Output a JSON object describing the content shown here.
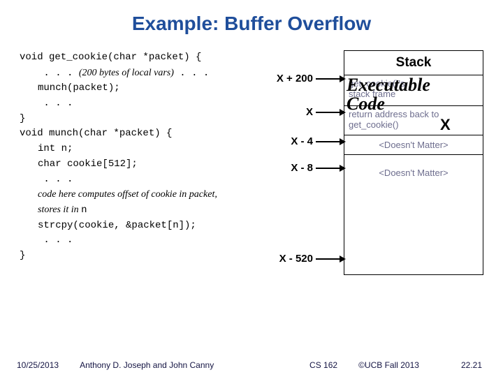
{
  "title": "Example: Buffer Overflow",
  "code": {
    "l1": "void get_cookie(char *packet) {",
    "l2a": " . . . ",
    "l2b": "(200 bytes of local vars)",
    "l2c": " . . .",
    "l3": "munch(packet);",
    "l4": " . . .",
    "l5": "}",
    "l6": "void munch(char *packet) {",
    "l7": "int n;",
    "l8": "char cookie[512];",
    "l9": " . . .",
    "l10": "code here computes offset of cookie in\npacket, stores it in ",
    "l10b": "n",
    "l11": "strcpy(cookie, &packet[n]);",
    "l12": " . . .",
    "l13": "}"
  },
  "addresses": {
    "a1": "X + 200",
    "a2": "X",
    "a3": "X - 4",
    "a4": "X - 8",
    "a5": "X - 520"
  },
  "stack": {
    "header": "Stack",
    "frame1": "get_cookie()'s",
    "frame2": "stack frame",
    "ret": "return address back to get_cookie()",
    "dm": "<Doesn't Matter>"
  },
  "overlay": {
    "line1": "Executable",
    "line2": "Code",
    "x": "X"
  },
  "footer": {
    "date": "10/25/2013",
    "authors": "Anthony D. Joseph and John Canny",
    "course": "CS 162",
    "copyright": "©UCB Fall 2013",
    "slide": "22.21"
  }
}
